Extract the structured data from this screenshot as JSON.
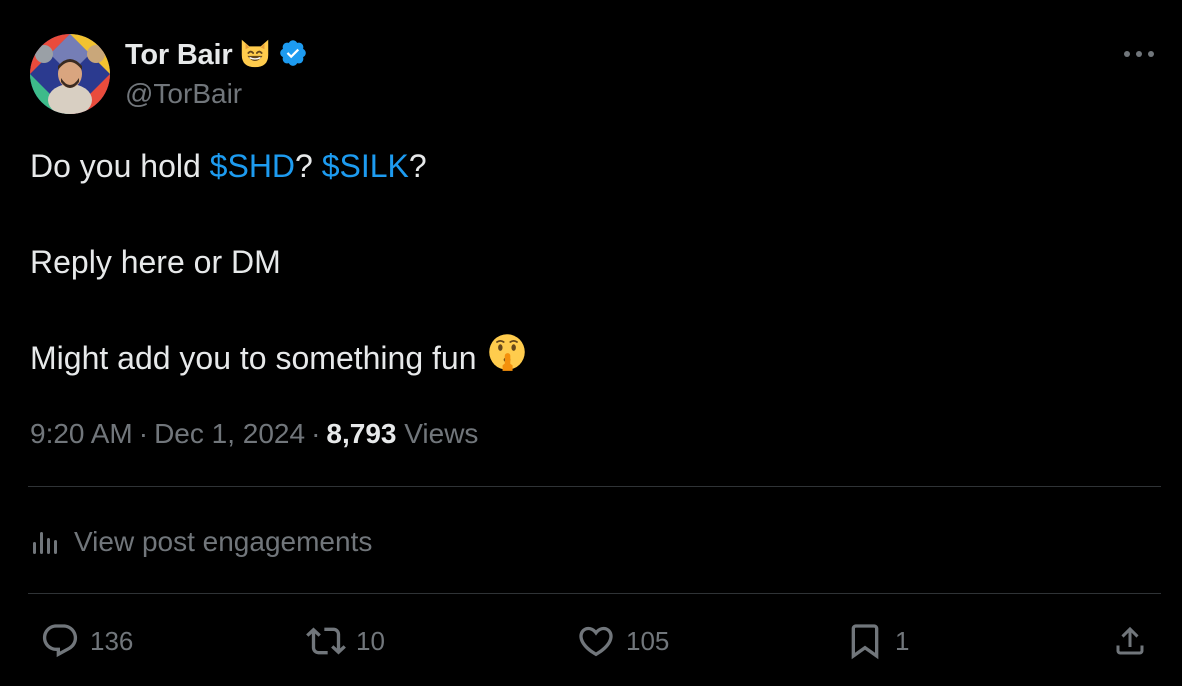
{
  "author": {
    "display_name": "Tor Bair",
    "handle": "@TorBair",
    "name_emoji": "smiling-cat-emoji",
    "verified_icon": "verified-badge-icon",
    "verified_color": "#1d9bf0"
  },
  "post": {
    "line1_prefix": "Do you hold ",
    "cashtag1": "$SHD",
    "line1_middle": "? ",
    "cashtag2": "$SILK",
    "line1_suffix": "?",
    "line2": "Reply here or DM",
    "line3": "Might add you to something fun",
    "line3_emoji": "shushing-face-emoji"
  },
  "meta": {
    "time": "9:20 AM",
    "separator": "·",
    "date": "Dec 1, 2024",
    "views_count": "8,793",
    "views_label": "Views"
  },
  "engagements": {
    "label": "View post engagements",
    "icon": "analytics-icon"
  },
  "actions": {
    "replies": "136",
    "reposts": "10",
    "likes": "105",
    "bookmarks": "1"
  },
  "colors": {
    "background": "#000000",
    "text_primary": "#e7e9ea",
    "text_secondary": "#71767b",
    "accent": "#1d9bf0",
    "divider": "#2f3336"
  }
}
